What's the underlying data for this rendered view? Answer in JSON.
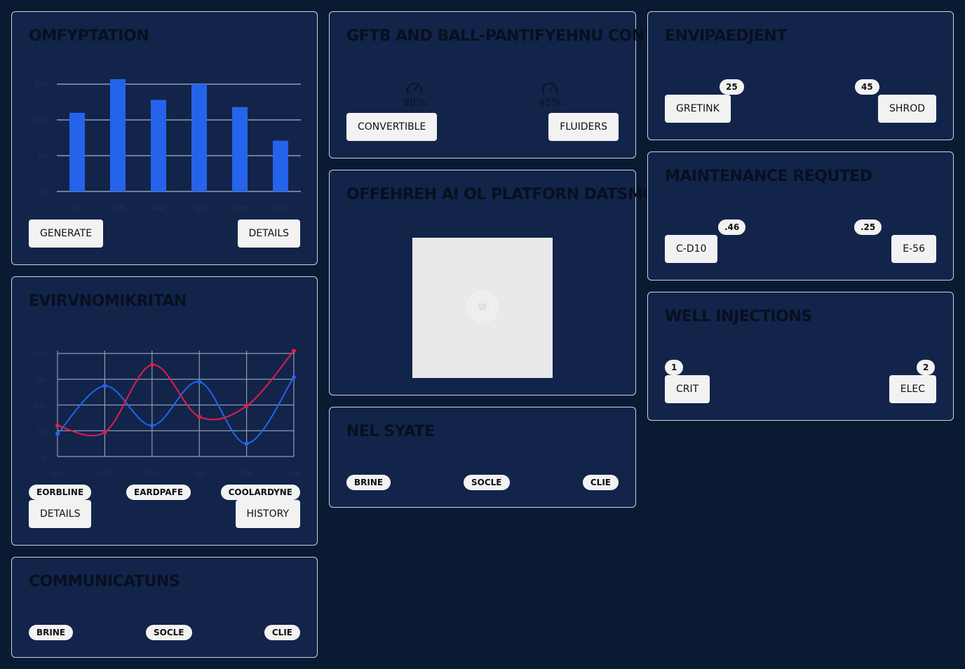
{
  "cards": {
    "omfyptation": {
      "title": "OMFYPTATION",
      "buttons": {
        "generate": "GENERATE",
        "details": "DETAILS"
      }
    },
    "evirvnomikritan": {
      "title": "EVIRVNOMIKRITAN",
      "pills": [
        "EORBLINE",
        "EARDPAFE",
        "COOLARDYNE"
      ],
      "buttons": {
        "details": "DETAILS",
        "history": "HISTORY"
      }
    },
    "communicatuns": {
      "title": "COMMUNICATUNS",
      "pills": [
        "BRINE",
        "SOCLE",
        "CLIE"
      ]
    },
    "gftb": {
      "title": "GFTB AND BALL-PANTIFYEHNU CONT",
      "gauges": [
        "98%",
        "45%"
      ],
      "buttons": {
        "convertible": "CONVERTIBLE",
        "fluiders": "FLUIDERS"
      }
    },
    "offehreh": {
      "title": "OFFEHREH AI OL PLATFORN DATSMOD"
    },
    "nel_syate": {
      "title": "NEL SYATE",
      "pills": [
        "BRINE",
        "SOCLE",
        "CLIE"
      ]
    },
    "envipaedjent": {
      "title": "ENVIPAEDJENT",
      "badges": [
        "25",
        "45"
      ],
      "buttons": {
        "gretink": "GRETINK",
        "shrod": "SHROD"
      }
    },
    "maintenance": {
      "title": "MAINTENANCE REQUTED",
      "badges": [
        ".46",
        ".25"
      ],
      "buttons": {
        "c_d10": "C-D10",
        "e_56": "E-56"
      }
    },
    "well_injections": {
      "title": "WELL INJECTIONS",
      "badges": [
        "1",
        "2"
      ],
      "buttons": {
        "crit": "CRIT",
        "elec": "ELEC"
      }
    }
  },
  "colors": {
    "background": "#0b1a33",
    "card": "#12244a",
    "bar": "#2563eb",
    "line_blue": "#2563eb",
    "line_red": "#e11d48"
  },
  "chart_data": [
    {
      "type": "bar",
      "categories": [
        "Jan",
        "Feb",
        "Mar",
        "Apr",
        "May",
        "Jun"
      ],
      "values": [
        110,
        157,
        128,
        150,
        118,
        71
      ],
      "yticks": [
        0,
        50,
        100,
        150
      ],
      "ylim": [
        0,
        150
      ],
      "grid": true
    },
    {
      "type": "line",
      "categories": [
        "Jan",
        "Feb",
        "Mar",
        "Apr",
        "May",
        "Jun"
      ],
      "series": [
        {
          "color": "#2563eb",
          "values": [
            44,
            137,
            60,
            145,
            25,
            154
          ]
        },
        {
          "color": "#e11d48",
          "values": [
            60,
            47,
            178,
            77,
            98,
            205
          ]
        }
      ],
      "yticks": [
        0,
        50,
        100,
        150,
        200
      ],
      "ylim": [
        0,
        200
      ],
      "grid": true
    }
  ]
}
